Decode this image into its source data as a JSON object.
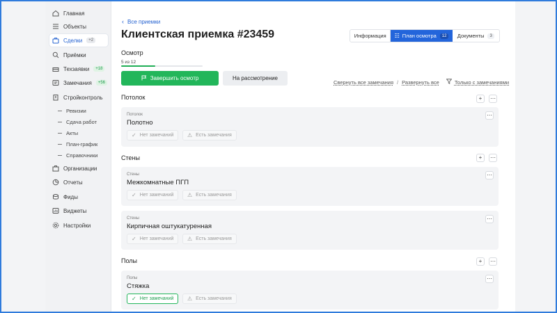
{
  "sidebar": {
    "items": [
      {
        "label": "Главная",
        "icon": "home-icon"
      },
      {
        "label": "Объекты",
        "icon": "list-icon"
      },
      {
        "label": "Сделки",
        "icon": "briefcase-icon",
        "badge": "+2",
        "active": true
      },
      {
        "label": "Приёмки",
        "icon": "inspect-icon"
      },
      {
        "label": "Техзаявки",
        "icon": "toolbox-icon",
        "badge": "+18"
      },
      {
        "label": "Замечания",
        "icon": "warning-list-icon",
        "badge": "+56"
      },
      {
        "label": "Стройконтроль",
        "icon": "building-icon"
      }
    ],
    "subitems": [
      "Ревизии",
      "Сдача работ",
      "Акты",
      "План-график",
      "Справочники"
    ],
    "bottom_items": [
      {
        "label": "Организации",
        "icon": "organization-icon"
      },
      {
        "label": "Отчеты",
        "icon": "report-icon"
      },
      {
        "label": "Фиды",
        "icon": "feed-icon"
      },
      {
        "label": "Виджеты",
        "icon": "widget-icon"
      },
      {
        "label": "Настройки",
        "icon": "settings-icon"
      }
    ]
  },
  "header": {
    "back_label": "Все приемки",
    "title": "Клиентская приемка #23459",
    "tabs": [
      {
        "label": "Информация"
      },
      {
        "label": "План осмотра",
        "count": "12",
        "active": true
      },
      {
        "label": "Документы",
        "count": "3"
      }
    ]
  },
  "inspection": {
    "label": "Осмотр",
    "progress_text": "5 из 12",
    "progress": 0.4167,
    "finish_label": "Завершить осмотр",
    "review_label": "На рассмотрение",
    "collapse_all": "Свернуть все замечания",
    "separator": "/",
    "expand_all": "Развернуть все",
    "filter_label": "Только с замечаниями"
  },
  "chips": {
    "no_issues": "Нет замечаний",
    "has_issues": "Есть замечания"
  },
  "groups": [
    {
      "title": "Потолок",
      "cards": [
        {
          "category": "Потолок",
          "name": "Полотно",
          "selected": null
        }
      ]
    },
    {
      "title": "Стены",
      "cards": [
        {
          "category": "Стены",
          "name": "Межкомнатные ПГП",
          "selected": null
        },
        {
          "category": "Стены",
          "name": "Кирпичная оштукатуренная",
          "selected": null
        }
      ]
    },
    {
      "title": "Полы",
      "cards": [
        {
          "category": "Полы",
          "name": "Стяжка",
          "selected": "no_issues"
        }
      ]
    }
  ],
  "colors": {
    "accent": "#2365db",
    "success": "#22b65a",
    "frame": "#2f7bdc"
  }
}
